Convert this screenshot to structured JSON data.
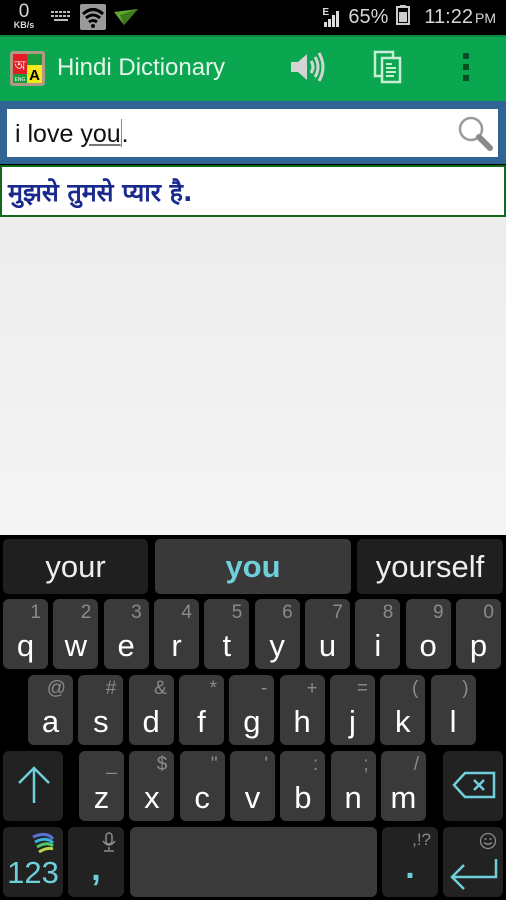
{
  "status_bar": {
    "net_speed_value": "0",
    "net_speed_unit": "KB/s",
    "network_type": "E",
    "battery_percent": "65%",
    "time": "11:22",
    "ampm": "PM",
    "icons": [
      "keyboard-icon",
      "wifi-icon",
      "paper-plane-icon",
      "signal-icon",
      "battery-icon"
    ]
  },
  "app_bar": {
    "title": "Hindi Dictionary",
    "logo_letters": [
      "অ",
      "A",
      "ENG"
    ],
    "actions": [
      "speaker-icon",
      "copy-icon",
      "overflow-menu-icon"
    ],
    "color": "#0aa650"
  },
  "search": {
    "value_before": "i love ",
    "value_underlined": "you",
    "value_after": ".",
    "button": "search-icon"
  },
  "result": {
    "translation": "मुझसे तुमसे प्यार है."
  },
  "keyboard": {
    "suggestions": [
      "your",
      "you",
      "yourself"
    ],
    "row1": [
      {
        "key": "q",
        "hint": "1"
      },
      {
        "key": "w",
        "hint": "2"
      },
      {
        "key": "e",
        "hint": "3"
      },
      {
        "key": "r",
        "hint": "4"
      },
      {
        "key": "t",
        "hint": "5"
      },
      {
        "key": "y",
        "hint": "6"
      },
      {
        "key": "u",
        "hint": "7"
      },
      {
        "key": "i",
        "hint": "8"
      },
      {
        "key": "o",
        "hint": "9"
      },
      {
        "key": "p",
        "hint": "0"
      }
    ],
    "row2": [
      {
        "key": "a",
        "hint": "@"
      },
      {
        "key": "s",
        "hint": "#"
      },
      {
        "key": "d",
        "hint": "&"
      },
      {
        "key": "f",
        "hint": "*"
      },
      {
        "key": "g",
        "hint": "-"
      },
      {
        "key": "h",
        "hint": "+"
      },
      {
        "key": "j",
        "hint": "="
      },
      {
        "key": "k",
        "hint": "("
      },
      {
        "key": "l",
        "hint": ")"
      }
    ],
    "row3": [
      {
        "key": "z",
        "hint": "_"
      },
      {
        "key": "x",
        "hint": "$"
      },
      {
        "key": "c",
        "hint": "\""
      },
      {
        "key": "v",
        "hint": "'"
      },
      {
        "key": "b",
        "hint": ":"
      },
      {
        "key": "n",
        "hint": ";"
      },
      {
        "key": "m",
        "hint": "/"
      }
    ],
    "row4": {
      "symbols_label": "123",
      "comma": ",",
      "period": ".",
      "period_hint": ",!?"
    },
    "accent_color": "#6fd0dc"
  }
}
